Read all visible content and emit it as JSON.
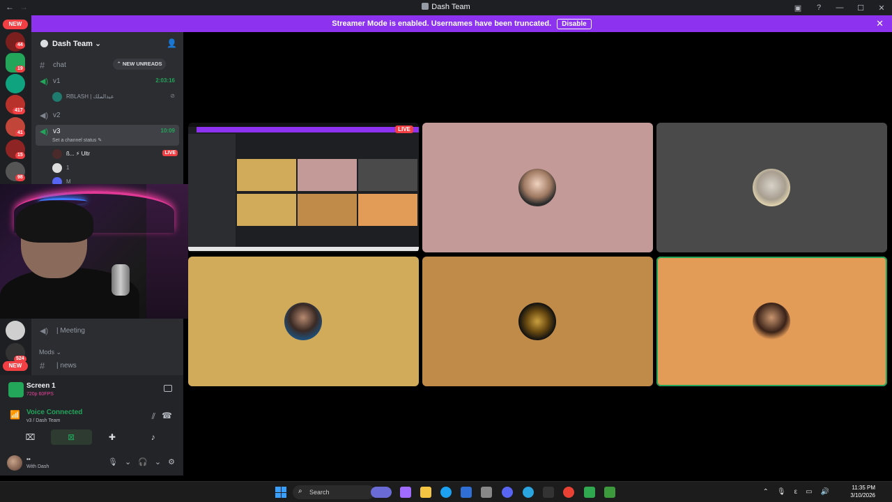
{
  "window": {
    "title": "Dash Team"
  },
  "banner": {
    "text": "Streamer Mode is enabled. Usernames have been truncated.",
    "button": "Disable"
  },
  "rail": {
    "new_top": "NEW",
    "badges": [
      "44",
      "19",
      "417",
      "41",
      "15",
      "98",
      "524"
    ],
    "new_bottom": "NEW"
  },
  "sidebar": {
    "server_name": "Dash Team",
    "new_unreads": "NEW UNREADS",
    "channels": {
      "chat": "chat",
      "v1": "v1",
      "v1_time": "2:03:16",
      "v1_user": "RBLASH | عبدالملك",
      "v2": "v2",
      "v3": "v3",
      "v3_time": "10:09",
      "v3_status": "Set a channel status",
      "v3_user1": "ß... ⚡ Ultr",
      "v3_user1_live": "LIVE",
      "v3_user2": "1",
      "v3_user3": "M",
      "meeting": "| Meeting",
      "mods_category": "Mods",
      "news": "| news"
    }
  },
  "panel": {
    "screen_title": "Screen 1",
    "screen_sub": "720p 60FPS",
    "voice_title": "Voice Connected",
    "voice_sub": "v3 / Dash Team",
    "user_status": "With Dash"
  },
  "stage": {
    "live_tag": "LIVE"
  },
  "taskbar": {
    "search": "Search",
    "time": "11:35 PM",
    "date": "3/10/2026"
  },
  "colors": {
    "banner": "#8d33f0",
    "tile_pink": "#c49a98",
    "tile_gray": "#4a4a4a",
    "tile_mustard": "#d1ab5a",
    "tile_bronze": "#c08a48",
    "tile_orange": "#e39b58",
    "voice_green": "#23a55a"
  }
}
